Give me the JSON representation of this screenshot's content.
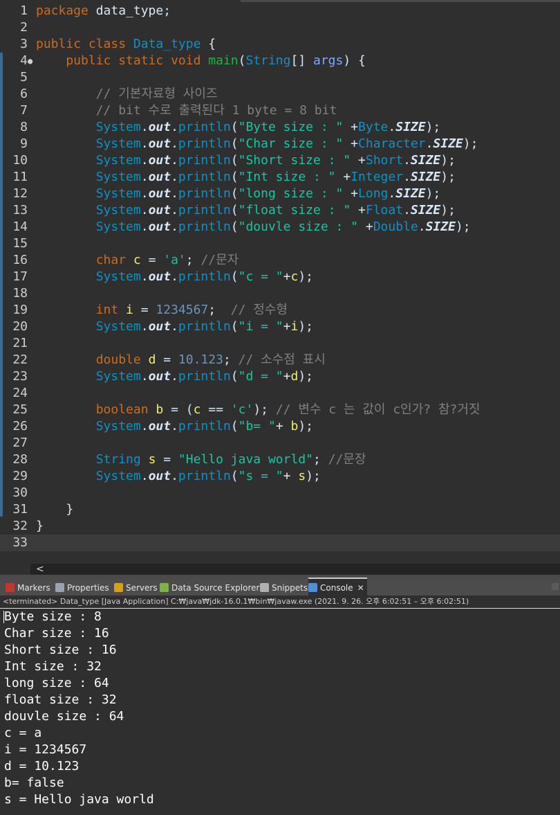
{
  "editor": {
    "lines": [
      {
        "n": "1",
        "tokens": [
          {
            "t": "package",
            "c": "kw"
          },
          {
            "t": " data_type;",
            "c": "plain"
          }
        ]
      },
      {
        "n": "2",
        "tokens": []
      },
      {
        "n": "3",
        "tokens": [
          {
            "t": "public class ",
            "c": "kw"
          },
          {
            "t": "Data_type",
            "c": "cls"
          },
          {
            "t": " {",
            "c": "plain"
          }
        ]
      },
      {
        "n": "4",
        "tokens": [
          {
            "t": "    public static void ",
            "c": "kw"
          },
          {
            "t": "main",
            "c": "mth"
          },
          {
            "t": "(",
            "c": "plain"
          },
          {
            "t": "String",
            "c": "cls"
          },
          {
            "t": "[] ",
            "c": "plain"
          },
          {
            "t": "args",
            "c": "par"
          },
          {
            "t": ") {",
            "c": "plain"
          }
        ]
      },
      {
        "n": "5",
        "tokens": []
      },
      {
        "n": "6",
        "tokens": [
          {
            "t": "        // 기본자료형 사이즈",
            "c": "cmt"
          }
        ]
      },
      {
        "n": "7",
        "tokens": [
          {
            "t": "        // bit 수로 출력된다 1 byte = 8 bit",
            "c": "cmt"
          }
        ]
      },
      {
        "n": "8",
        "tokens": [
          {
            "t": "        System",
            "c": "sys"
          },
          {
            "t": ".",
            "c": "plain"
          },
          {
            "t": "out",
            "c": "out"
          },
          {
            "t": ".",
            "c": "plain"
          },
          {
            "t": "println",
            "c": "sys"
          },
          {
            "t": "(",
            "c": "plain"
          },
          {
            "t": "\"Byte size : \"",
            "c": "str"
          },
          {
            "t": " +",
            "c": "plain"
          },
          {
            "t": "Byte",
            "c": "cls"
          },
          {
            "t": ".",
            "c": "plain"
          },
          {
            "t": "SIZE",
            "c": "sz"
          },
          {
            "t": ");",
            "c": "plain"
          }
        ]
      },
      {
        "n": "9",
        "tokens": [
          {
            "t": "        System",
            "c": "sys"
          },
          {
            "t": ".",
            "c": "plain"
          },
          {
            "t": "out",
            "c": "out"
          },
          {
            "t": ".",
            "c": "plain"
          },
          {
            "t": "println",
            "c": "sys"
          },
          {
            "t": "(",
            "c": "plain"
          },
          {
            "t": "\"Char size : \"",
            "c": "str"
          },
          {
            "t": " +",
            "c": "plain"
          },
          {
            "t": "Character",
            "c": "cls"
          },
          {
            "t": ".",
            "c": "plain"
          },
          {
            "t": "SIZE",
            "c": "sz"
          },
          {
            "t": ");",
            "c": "plain"
          }
        ]
      },
      {
        "n": "10",
        "tokens": [
          {
            "t": "        System",
            "c": "sys"
          },
          {
            "t": ".",
            "c": "plain"
          },
          {
            "t": "out",
            "c": "out"
          },
          {
            "t": ".",
            "c": "plain"
          },
          {
            "t": "println",
            "c": "sys"
          },
          {
            "t": "(",
            "c": "plain"
          },
          {
            "t": "\"Short size : \"",
            "c": "str"
          },
          {
            "t": " +",
            "c": "plain"
          },
          {
            "t": "Short",
            "c": "cls"
          },
          {
            "t": ".",
            "c": "plain"
          },
          {
            "t": "SIZE",
            "c": "sz"
          },
          {
            "t": ");",
            "c": "plain"
          }
        ]
      },
      {
        "n": "11",
        "tokens": [
          {
            "t": "        System",
            "c": "sys"
          },
          {
            "t": ".",
            "c": "plain"
          },
          {
            "t": "out",
            "c": "out"
          },
          {
            "t": ".",
            "c": "plain"
          },
          {
            "t": "println",
            "c": "sys"
          },
          {
            "t": "(",
            "c": "plain"
          },
          {
            "t": "\"Int size : \"",
            "c": "str"
          },
          {
            "t": " +",
            "c": "plain"
          },
          {
            "t": "Integer",
            "c": "cls"
          },
          {
            "t": ".",
            "c": "plain"
          },
          {
            "t": "SIZE",
            "c": "sz"
          },
          {
            "t": ");",
            "c": "plain"
          }
        ]
      },
      {
        "n": "12",
        "tokens": [
          {
            "t": "        System",
            "c": "sys"
          },
          {
            "t": ".",
            "c": "plain"
          },
          {
            "t": "out",
            "c": "out"
          },
          {
            "t": ".",
            "c": "plain"
          },
          {
            "t": "println",
            "c": "sys"
          },
          {
            "t": "(",
            "c": "plain"
          },
          {
            "t": "\"long size : \"",
            "c": "str"
          },
          {
            "t": " +",
            "c": "plain"
          },
          {
            "t": "Long",
            "c": "cls"
          },
          {
            "t": ".",
            "c": "plain"
          },
          {
            "t": "SIZE",
            "c": "sz"
          },
          {
            "t": ");",
            "c": "plain"
          }
        ]
      },
      {
        "n": "13",
        "tokens": [
          {
            "t": "        System",
            "c": "sys"
          },
          {
            "t": ".",
            "c": "plain"
          },
          {
            "t": "out",
            "c": "out"
          },
          {
            "t": ".",
            "c": "plain"
          },
          {
            "t": "println",
            "c": "sys"
          },
          {
            "t": "(",
            "c": "plain"
          },
          {
            "t": "\"float size : \"",
            "c": "str"
          },
          {
            "t": " +",
            "c": "plain"
          },
          {
            "t": "Float",
            "c": "cls"
          },
          {
            "t": ".",
            "c": "plain"
          },
          {
            "t": "SIZE",
            "c": "sz"
          },
          {
            "t": ");",
            "c": "plain"
          }
        ]
      },
      {
        "n": "14",
        "tokens": [
          {
            "t": "        System",
            "c": "sys"
          },
          {
            "t": ".",
            "c": "plain"
          },
          {
            "t": "out",
            "c": "out"
          },
          {
            "t": ".",
            "c": "plain"
          },
          {
            "t": "println",
            "c": "sys"
          },
          {
            "t": "(",
            "c": "plain"
          },
          {
            "t": "\"douvle size : \"",
            "c": "str"
          },
          {
            "t": " +",
            "c": "plain"
          },
          {
            "t": "Double",
            "c": "cls"
          },
          {
            "t": ".",
            "c": "plain"
          },
          {
            "t": "SIZE",
            "c": "sz"
          },
          {
            "t": ");",
            "c": "plain"
          }
        ]
      },
      {
        "n": "15",
        "tokens": []
      },
      {
        "n": "16",
        "tokens": [
          {
            "t": "        char ",
            "c": "kw"
          },
          {
            "t": "c",
            "c": "var"
          },
          {
            "t": " = ",
            "c": "plain"
          },
          {
            "t": "'a'",
            "c": "str"
          },
          {
            "t": "; ",
            "c": "plain"
          },
          {
            "t": "//문자",
            "c": "cmt"
          }
        ]
      },
      {
        "n": "17",
        "tokens": [
          {
            "t": "        System",
            "c": "sys"
          },
          {
            "t": ".",
            "c": "plain"
          },
          {
            "t": "out",
            "c": "out"
          },
          {
            "t": ".",
            "c": "plain"
          },
          {
            "t": "println",
            "c": "sys"
          },
          {
            "t": "(",
            "c": "plain"
          },
          {
            "t": "\"c = \"",
            "c": "str"
          },
          {
            "t": "+",
            "c": "plain"
          },
          {
            "t": "c",
            "c": "var"
          },
          {
            "t": ");",
            "c": "plain"
          }
        ]
      },
      {
        "n": "18",
        "tokens": []
      },
      {
        "n": "19",
        "tokens": [
          {
            "t": "        int ",
            "c": "kw"
          },
          {
            "t": "i",
            "c": "var"
          },
          {
            "t": " = ",
            "c": "plain"
          },
          {
            "t": "1234567",
            "c": "num"
          },
          {
            "t": ";  ",
            "c": "plain"
          },
          {
            "t": "// 정수형",
            "c": "cmt"
          }
        ]
      },
      {
        "n": "20",
        "tokens": [
          {
            "t": "        System",
            "c": "sys"
          },
          {
            "t": ".",
            "c": "plain"
          },
          {
            "t": "out",
            "c": "out"
          },
          {
            "t": ".",
            "c": "plain"
          },
          {
            "t": "println",
            "c": "sys"
          },
          {
            "t": "(",
            "c": "plain"
          },
          {
            "t": "\"i = \"",
            "c": "str"
          },
          {
            "t": "+",
            "c": "plain"
          },
          {
            "t": "i",
            "c": "var"
          },
          {
            "t": ");",
            "c": "plain"
          }
        ]
      },
      {
        "n": "21",
        "tokens": []
      },
      {
        "n": "22",
        "tokens": [
          {
            "t": "        double ",
            "c": "kw"
          },
          {
            "t": "d",
            "c": "var"
          },
          {
            "t": " = ",
            "c": "plain"
          },
          {
            "t": "10.123",
            "c": "num"
          },
          {
            "t": "; ",
            "c": "plain"
          },
          {
            "t": "// 소수점 표시",
            "c": "cmt"
          }
        ]
      },
      {
        "n": "23",
        "tokens": [
          {
            "t": "        System",
            "c": "sys"
          },
          {
            "t": ".",
            "c": "plain"
          },
          {
            "t": "out",
            "c": "out"
          },
          {
            "t": ".",
            "c": "plain"
          },
          {
            "t": "println",
            "c": "sys"
          },
          {
            "t": "(",
            "c": "plain"
          },
          {
            "t": "\"d = \"",
            "c": "str"
          },
          {
            "t": "+",
            "c": "plain"
          },
          {
            "t": "d",
            "c": "var"
          },
          {
            "t": ");",
            "c": "plain"
          }
        ]
      },
      {
        "n": "24",
        "tokens": []
      },
      {
        "n": "25",
        "tokens": [
          {
            "t": "        boolean ",
            "c": "kw"
          },
          {
            "t": "b",
            "c": "var"
          },
          {
            "t": " = (",
            "c": "plain"
          },
          {
            "t": "c",
            "c": "var"
          },
          {
            "t": " == ",
            "c": "plain"
          },
          {
            "t": "'c'",
            "c": "str"
          },
          {
            "t": "); ",
            "c": "plain"
          },
          {
            "t": "// 변수 c 는 값이 c인가? 참?거짓",
            "c": "cmt"
          }
        ]
      },
      {
        "n": "26",
        "tokens": [
          {
            "t": "        System",
            "c": "sys"
          },
          {
            "t": ".",
            "c": "plain"
          },
          {
            "t": "out",
            "c": "out"
          },
          {
            "t": ".",
            "c": "plain"
          },
          {
            "t": "println",
            "c": "sys"
          },
          {
            "t": "(",
            "c": "plain"
          },
          {
            "t": "\"b= \"",
            "c": "str"
          },
          {
            "t": "+ ",
            "c": "plain"
          },
          {
            "t": "b",
            "c": "var"
          },
          {
            "t": ");",
            "c": "plain"
          }
        ]
      },
      {
        "n": "27",
        "tokens": []
      },
      {
        "n": "28",
        "tokens": [
          {
            "t": "        String ",
            "c": "cls"
          },
          {
            "t": "s",
            "c": "var"
          },
          {
            "t": " = ",
            "c": "plain"
          },
          {
            "t": "\"Hello java world\"",
            "c": "str"
          },
          {
            "t": "; ",
            "c": "plain"
          },
          {
            "t": "//문장",
            "c": "cmt"
          }
        ]
      },
      {
        "n": "29",
        "tokens": [
          {
            "t": "        System",
            "c": "sys"
          },
          {
            "t": ".",
            "c": "plain"
          },
          {
            "t": "out",
            "c": "out"
          },
          {
            "t": ".",
            "c": "plain"
          },
          {
            "t": "println",
            "c": "sys"
          },
          {
            "t": "(",
            "c": "plain"
          },
          {
            "t": "\"s = \"",
            "c": "str"
          },
          {
            "t": "+ ",
            "c": "plain"
          },
          {
            "t": "s",
            "c": "var"
          },
          {
            "t": ");",
            "c": "plain"
          }
        ]
      },
      {
        "n": "30",
        "tokens": []
      },
      {
        "n": "31",
        "tokens": [
          {
            "t": "    }",
            "c": "plain"
          }
        ]
      },
      {
        "n": "32",
        "tokens": [
          {
            "t": "}",
            "c": "plain"
          }
        ]
      },
      {
        "n": "33",
        "tokens": []
      }
    ],
    "current_line": "33",
    "fold_marker": "●",
    "scroll_arrow": "<"
  },
  "tabs": [
    {
      "label": "Markers",
      "icon": "markers-icon",
      "color": "#c0392b"
    },
    {
      "label": "Properties",
      "icon": "properties-icon",
      "color": "#9aa4b0"
    },
    {
      "label": "Servers",
      "icon": "servers-icon",
      "color": "#d4a017"
    },
    {
      "label": "Data Source Explorer",
      "icon": "data-source-explorer-icon",
      "color": "#7cb342"
    },
    {
      "label": "Snippets",
      "icon": "snippets-icon",
      "color": "#b0b0b0"
    },
    {
      "label": "Console",
      "icon": "console-icon",
      "color": "#4f8fd8",
      "active": true
    }
  ],
  "tab_close": "✕",
  "status": {
    "text": "<terminated> Data_type [Java Application] C:₩java₩jdk-16.0.1₩bin₩javaw.exe  (2021. 9. 26. 오후 6:02:51 – 오후 6:02:51)"
  },
  "console": {
    "lines": [
      "Byte size : 8",
      "Char size : 16",
      "Short size : 16",
      "Int size : 32",
      "long size : 64",
      "float size : 32",
      "douvle size : 64",
      "c = a",
      "i = 1234567",
      "d = 10.123",
      "b= false",
      "s = Hello java world"
    ]
  },
  "colors": {
    "background": "#2f2f2f",
    "keyword": "#cc6c1d",
    "class": "#1290c3",
    "string": "#17c6a3",
    "number": "#6897bb",
    "comment": "#808080",
    "variable": "#f3ec79",
    "method": "#1eb540"
  }
}
